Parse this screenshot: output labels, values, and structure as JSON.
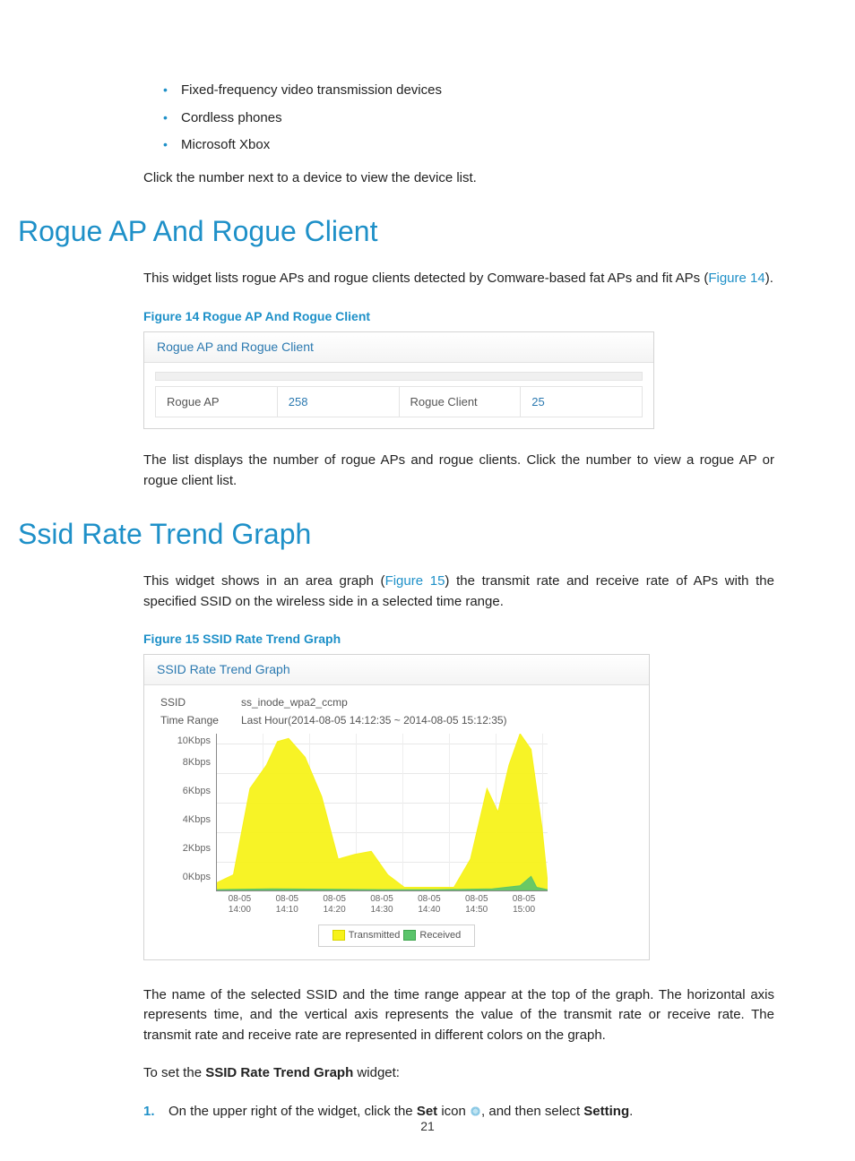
{
  "page_number": "21",
  "intro_list": [
    "Fixed-frequency video transmission devices",
    "Cordless phones",
    "Microsoft Xbox"
  ],
  "intro_after": "Click the number next to a device to view the device list.",
  "section_rogue": {
    "heading": "Rogue AP And Rogue Client",
    "para_pre": "This widget lists rogue APs and rogue clients detected by Comware-based fat APs and fit APs (",
    "link": "Figure 14",
    "para_post": ").",
    "fig_caption": "Figure 14 Rogue AP And Rogue Client",
    "widget_title": "Rogue AP and Rogue Client",
    "row": {
      "ap_label": "Rogue AP",
      "ap_count": "258",
      "client_label": "Rogue Client",
      "client_count": "25"
    },
    "after": "The list displays the number of rogue APs and rogue clients. Click the number to view a rogue AP or rogue client list."
  },
  "section_ssid": {
    "heading": "Ssid Rate Trend Graph",
    "para_pre": "This widget shows in an area graph (",
    "link": "Figure 15",
    "para_post": ") the transmit rate and receive rate of APs with the specified SSID on the wireless side in a selected time range.",
    "fig_caption": "Figure 15 SSID Rate Trend Graph",
    "widget_title": "SSID Rate Trend Graph",
    "info": {
      "ssid_label": "SSID",
      "ssid_value": "ss_inode_wpa2_ccmp",
      "time_label": "Time Range",
      "time_value": "Last Hour(2014-08-05 14:12:35 ~ 2014-08-05 15:12:35)"
    },
    "legend": {
      "tx": "Transmitted",
      "rx": "Received"
    },
    "after1": "The name of the selected SSID and the time range appear at the top of the graph. The horizontal axis represents time, and the vertical axis represents the value of the transmit rate or receive rate. The transmit rate and receive rate are represented in different colors on the graph.",
    "after2_pre": "To set the ",
    "after2_bold": "SSID Rate Trend Graph",
    "after2_post": " widget:",
    "step1_pre": "On the upper right of the widget, click the ",
    "step1_b1": "Set",
    "step1_mid": " icon ",
    "step1_post": ", and then select ",
    "step1_b2": "Setting",
    "step1_end": "."
  },
  "chart_data": {
    "type": "area",
    "title": "SSID Rate Trend Graph",
    "xlabel": "",
    "ylabel": "",
    "ylim": [
      0,
      10
    ],
    "y_unit": "Kbps",
    "y_ticks": [
      "10Kbps",
      "8Kbps",
      "6Kbps",
      "4Kbps",
      "2Kbps",
      "0Kbps"
    ],
    "x_ticks": [
      {
        "d": "08-05",
        "t": "14:00"
      },
      {
        "d": "08-05",
        "t": "14:10"
      },
      {
        "d": "08-05",
        "t": "14:20"
      },
      {
        "d": "08-05",
        "t": "14:30"
      },
      {
        "d": "08-05",
        "t": "14:40"
      },
      {
        "d": "08-05",
        "t": "14:50"
      },
      {
        "d": "08-05",
        "t": "15:00"
      }
    ],
    "series": [
      {
        "name": "Transmitted",
        "color": "#f7f21a",
        "points": [
          [
            0.0,
            0.5
          ],
          [
            3,
            1.0
          ],
          [
            6,
            6.5
          ],
          [
            9,
            8.0
          ],
          [
            11,
            9.5
          ],
          [
            13,
            9.7
          ],
          [
            16,
            8.5
          ],
          [
            19,
            6.0
          ],
          [
            22,
            2.0
          ],
          [
            25,
            2.3
          ],
          [
            28,
            2.5
          ],
          [
            31,
            1.0
          ],
          [
            34,
            0.2
          ],
          [
            37,
            0.2
          ],
          [
            40,
            0.2
          ],
          [
            43,
            0.2
          ],
          [
            46,
            2.0
          ],
          [
            49,
            6.5
          ],
          [
            51,
            5.0
          ],
          [
            53,
            8.0
          ],
          [
            55,
            10.0
          ],
          [
            57,
            9.0
          ],
          [
            59,
            4.0
          ],
          [
            60,
            0.5
          ]
        ]
      },
      {
        "name": "Received",
        "color": "#5ac46b",
        "points": [
          [
            0.0,
            0.05
          ],
          [
            10,
            0.1
          ],
          [
            20,
            0.08
          ],
          [
            30,
            0.05
          ],
          [
            40,
            0.05
          ],
          [
            50,
            0.1
          ],
          [
            55,
            0.3
          ],
          [
            57,
            0.9
          ],
          [
            58,
            0.2
          ],
          [
            60,
            0.05
          ]
        ]
      }
    ]
  }
}
